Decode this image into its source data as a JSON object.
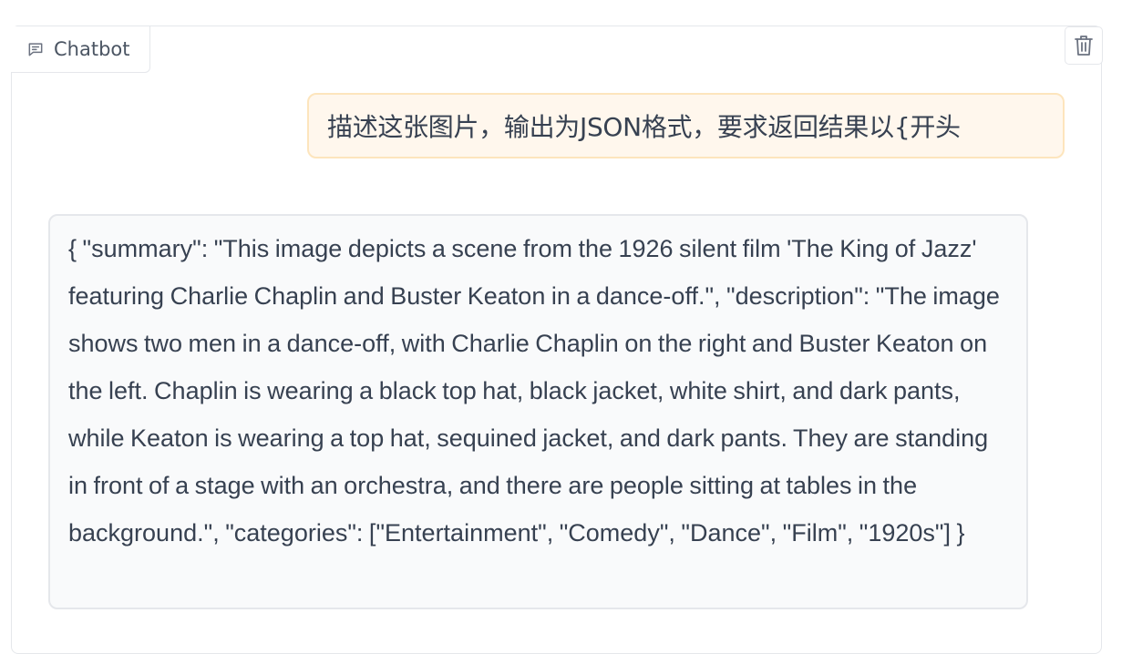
{
  "chatbot": {
    "label": "Chatbot",
    "icons": {
      "label_icon": "chat-icon",
      "clear_icon": "trash-icon"
    }
  },
  "messages": [
    {
      "role": "user",
      "text": "描述这张图片，输出为JSON格式，要求返回结果以{开头"
    },
    {
      "role": "bot",
      "text": "{ \"summary\": \"This image depicts a scene from the 1926 silent film 'The King of Jazz' featuring Charlie Chaplin and Buster Keaton in a dance-off.\", \"description\": \"The image shows two men in a dance-off, with Charlie Chaplin on the right and Buster Keaton on the left. Chaplin is wearing a black top hat, black jacket, white shirt, and dark pants, while Keaton is wearing a top hat, sequined jacket, and dark pants. They are standing in front of a stage with an orchestra, and there are people sitting at tables in the background.\", \"categories\": [\"Entertainment\", \"Comedy\", \"Dance\", \"Film\", \"1920s\"] }"
    }
  ],
  "colors": {
    "user_bubble_bg": "#fff7ed",
    "user_bubble_border": "#fde5bd",
    "bot_bubble_bg": "#f9fafb",
    "border": "#e5e7eb",
    "text": "#374151"
  }
}
